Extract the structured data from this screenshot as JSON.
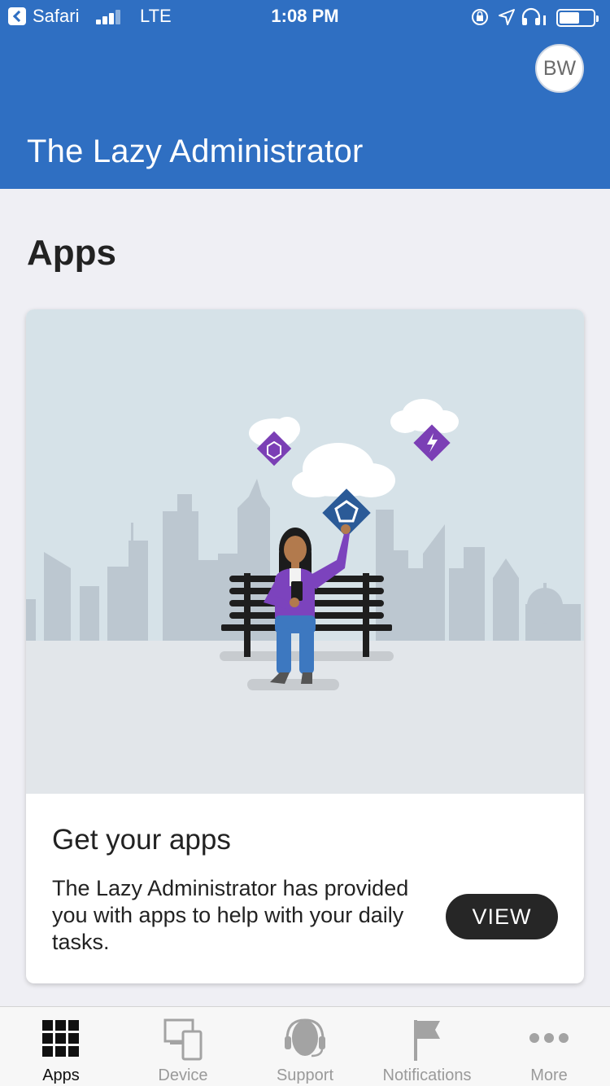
{
  "status_bar": {
    "back_app": "Safari",
    "network": "LTE",
    "time": "1:08 PM"
  },
  "header": {
    "avatar_initials": "BW",
    "org_name": "The Lazy Administrator"
  },
  "page": {
    "title": "Apps"
  },
  "card": {
    "heading": "Get your apps",
    "description": "The Lazy Administrator has provided you with apps to help with your daily tasks.",
    "view_label": "VIEW"
  },
  "tabs": [
    {
      "label": "Apps",
      "icon": "grid-icon",
      "active": true
    },
    {
      "label": "Device",
      "icon": "device-icon",
      "active": false
    },
    {
      "label": "Support",
      "icon": "headset-icon",
      "active": false
    },
    {
      "label": "Notifications",
      "icon": "flag-icon",
      "active": false
    },
    {
      "label": "More",
      "icon": "more-icon",
      "active": false
    }
  ],
  "colors": {
    "header_blue": "#2f6fc2",
    "accent_purple": "#7b3fb5",
    "tab_active": "#111111",
    "tab_inactive": "#9a9a9a"
  }
}
